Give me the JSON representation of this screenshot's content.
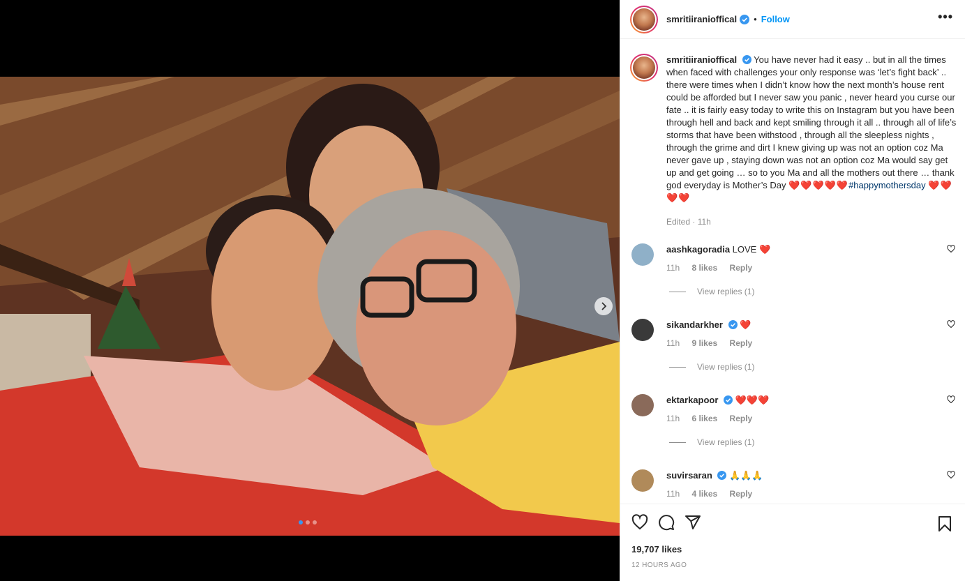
{
  "post": {
    "username": "smritiiranioffical",
    "follow_label": "Follow",
    "separator": "•",
    "more_label": "•••",
    "carousel": {
      "slides": 3,
      "active_slide": 1
    }
  },
  "caption": {
    "username": "smritiiranioffical",
    "text": "You have never had it easy .. but in all the times when faced with challenges your only response was ‘let’s fight back’ .. there were times when I didn’t know how the next month’s house rent could be afforded but I never saw you panic , never heard you curse our fate .. it is fairly easy today to write this on Instagram but you have been through hell and back and kept smiling through it all .. through all of life’s storms that have been withstood , through all the sleepless nights , through the grime and dirt I knew giving up was not an option coz Ma never gave up , staying down was not an option coz Ma would say get up and get going … so to you Ma and all the mothers out there … thank god everyday is Mother’s Day",
    "hearts_before": "❤️❤️❤️❤️❤️",
    "hashtag": "#happymothersday",
    "hearts_after": "❤️❤️❤️❤️",
    "edited": "Edited · 11h"
  },
  "comments": [
    {
      "username": "aashkagoradia",
      "verified": false,
      "text": "LOVE ❤️",
      "time": "11h",
      "likes": "8 likes",
      "reply": "Reply",
      "view_replies": "View replies (1)",
      "avatar_color": "#8fb0c8"
    },
    {
      "username": "sikandarkher",
      "verified": true,
      "text": "❤️",
      "time": "11h",
      "likes": "9 likes",
      "reply": "Reply",
      "view_replies": "View replies (1)",
      "avatar_color": "#3a3a3a"
    },
    {
      "username": "ektarkapoor",
      "verified": true,
      "text": "❤️❤️❤️",
      "time": "11h",
      "likes": "6 likes",
      "reply": "Reply",
      "view_replies": "View replies (1)",
      "avatar_color": "#8a6a5a"
    },
    {
      "username": "suvirsaran",
      "verified": true,
      "text": "🙏🙏🙏",
      "time": "11h",
      "likes": "4 likes",
      "reply": "Reply",
      "view_replies": "",
      "avatar_color": "#b08a5a"
    }
  ],
  "footer": {
    "likes": "19,707 likes",
    "time": "12 HOURS AGO"
  },
  "colors": {
    "accent": "#0095f6",
    "hashtag": "#00376b",
    "muted": "#8e8e8e",
    "heart": "#e0102b"
  },
  "icons": [
    "heart-icon",
    "comment-icon",
    "share-icon",
    "bookmark-icon",
    "verified-icon",
    "chevron-right-icon",
    "more-icon"
  ]
}
